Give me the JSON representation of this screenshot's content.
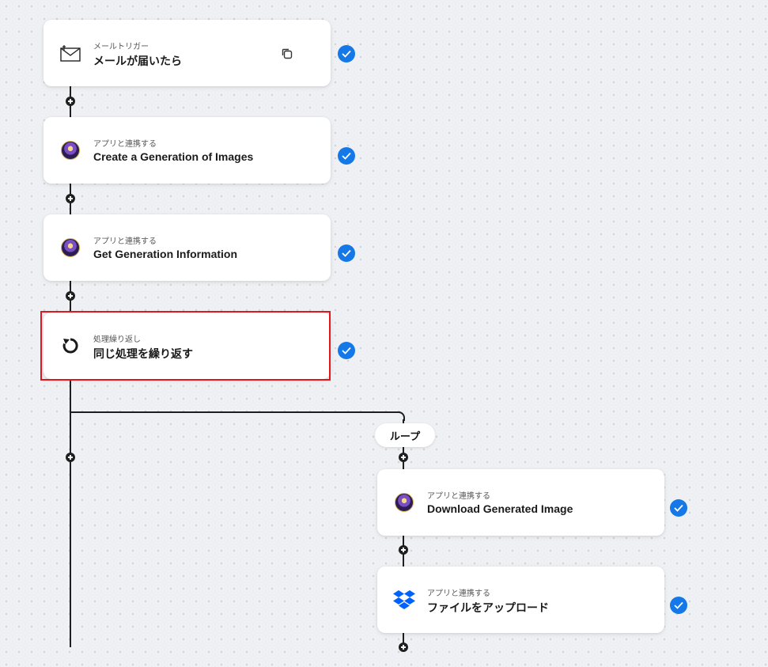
{
  "flow": {
    "steps": [
      {
        "category": "メールトリガー",
        "title": "メールが届いたら",
        "icon": "mail-icon"
      },
      {
        "category": "アプリと連携する",
        "title": "Create a Generation of Images",
        "icon": "leonardo-ai-app-icon"
      },
      {
        "category": "アプリと連携する",
        "title": "Get Generation Information",
        "icon": "leonardo-ai-app-icon"
      },
      {
        "category": "処理繰り返し",
        "title": "同じ処理を繰り返す",
        "icon": "loop-repeat-icon"
      }
    ],
    "loop_label": "ループ",
    "loop_steps": [
      {
        "category": "アプリと連携する",
        "title": "Download Generated Image",
        "icon": "leonardo-ai-app-icon"
      },
      {
        "category": "アプリと連携する",
        "title": "ファイルをアップロード",
        "icon": "dropbox-icon"
      }
    ]
  },
  "colors": {
    "check": "#1478e8",
    "highlight": "#e3161b",
    "line": "#1f1f1f"
  }
}
